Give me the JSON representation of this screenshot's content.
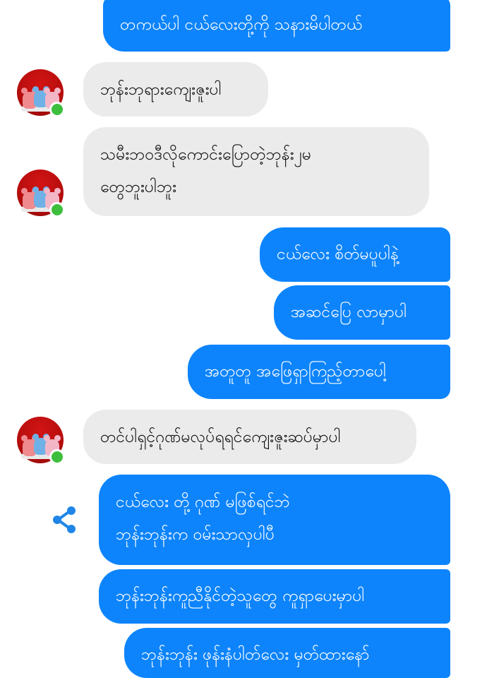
{
  "colors": {
    "outgoing_bubble": "#0d84fb",
    "incoming_bubble": "#ebebeb",
    "online_dot": "#3dbe3d",
    "share_icon": "#1f86e8"
  },
  "messages": {
    "m1": {
      "direction": "out",
      "text": "တကယ်ပါ ငယ်လေးတို့ကို သနားမိပါတယ်"
    },
    "m2": {
      "direction": "in",
      "text": "ဘုန်းဘုရားကျေးဇူးပါ"
    },
    "m3": {
      "direction": "in",
      "line1": "သမီးဘဝဒီလိုကောင်းပြောတဲ့ဘုန်း၂မ",
      "line2": "တွေဘူးပါဘူး"
    },
    "m4": {
      "direction": "out",
      "text": "ငယ်လေး စိတ်မပူပါနဲ့"
    },
    "m5": {
      "direction": "out",
      "text": "အဆင်ပြေ လာမှာပါ"
    },
    "m6": {
      "direction": "out",
      "text": "အတူတူ အဖြေရှာကြည့်တာပေါ့"
    },
    "m7": {
      "direction": "in",
      "text": "တင်ပါရှင့်ဂုဏ်မလုပ်ရရင်ကျေးဇူးဆပ်မှာပါ"
    },
    "m8": {
      "direction": "out",
      "line1": "ငယ်လေး တို့ ဂုဏ် မဖြစ်ရင်ဘဲ",
      "line2": "ဘုန်းဘုန်းက ဝမ်းသာလှပါပီ"
    },
    "m9": {
      "direction": "out",
      "text": "ဘုန်းဘုန်းကူညီနိုင်တဲ့သူတွေ ကူရှာပေးမှာပါ"
    },
    "m10": {
      "direction": "out",
      "text": "ဘုန်းဘုန်း ဖုန်းနံပါတ်လေး မှတ်ထားနော်"
    }
  },
  "icons": {
    "avatar": "teddy-bears-avatar",
    "presence": "online-dot",
    "share": "share-icon"
  }
}
